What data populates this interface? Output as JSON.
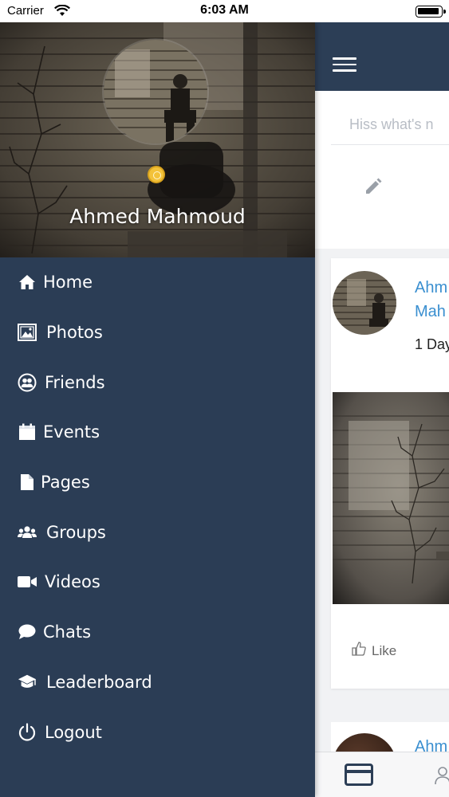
{
  "status_bar": {
    "carrier": "Carrier",
    "time": "6:03 AM"
  },
  "drawer": {
    "user_name": "Ahmed Mahmoud",
    "menu": [
      {
        "label": "Home",
        "icon": "home-icon"
      },
      {
        "label": "Photos",
        "icon": "photos-icon"
      },
      {
        "label": "Friends",
        "icon": "friends-icon"
      },
      {
        "label": "Events",
        "icon": "calendar-icon"
      },
      {
        "label": "Pages",
        "icon": "page-icon"
      },
      {
        "label": "Groups",
        "icon": "groups-icon"
      },
      {
        "label": "Videos",
        "icon": "video-icon"
      },
      {
        "label": "Chats",
        "icon": "chat-icon"
      },
      {
        "label": "Leaderboard",
        "icon": "graduation-cap-icon"
      },
      {
        "label": "Logout",
        "icon": "power-icon"
      }
    ]
  },
  "feed": {
    "composer_placeholder": "Hiss what's n",
    "post": {
      "author_line1": "Ahm",
      "author_line2": "Mah",
      "time": "1 Day",
      "like_label": "Like"
    },
    "post2": {
      "author": "Ahm"
    }
  },
  "colors": {
    "primary": "#2c3e56",
    "drawer_bg": "#2b3d55",
    "link": "#3a8fd0",
    "status_dot": "#f3c23a"
  }
}
